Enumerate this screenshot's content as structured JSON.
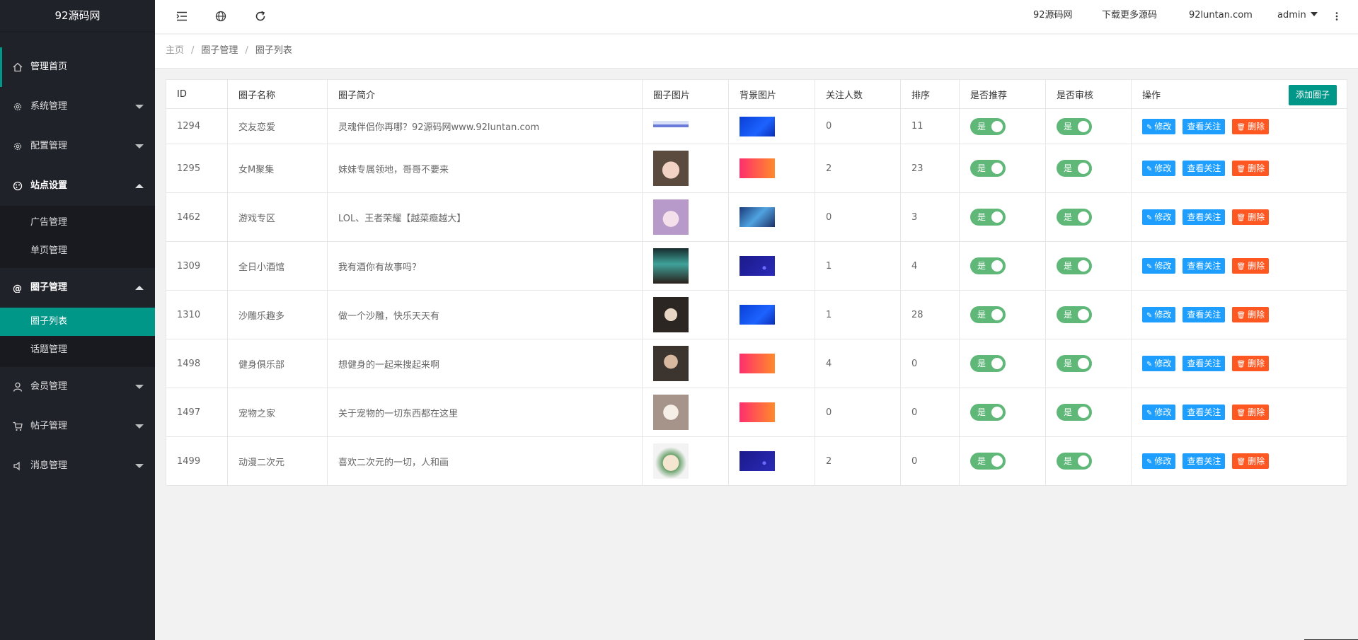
{
  "app": {
    "title": "92源码网"
  },
  "sidebar": {
    "items": [
      {
        "label": "管理首页",
        "icon": "home-icon"
      },
      {
        "label": "系统管理",
        "icon": "gear-icon"
      },
      {
        "label": "配置管理",
        "icon": "gear-icon"
      },
      {
        "label": "站点设置",
        "icon": "palette-icon",
        "sub": [
          "广告管理",
          "单页管理"
        ]
      },
      {
        "label": "圈子管理",
        "icon": "at-icon",
        "sub": [
          "圈子列表",
          "话题管理"
        ]
      },
      {
        "label": "会员管理",
        "icon": "user-icon"
      },
      {
        "label": "帖子管理",
        "icon": "cart-icon"
      },
      {
        "label": "消息管理",
        "icon": "speaker-icon"
      }
    ]
  },
  "header": {
    "links": [
      "92源码网",
      "下载更多源码",
      "92luntan.com"
    ],
    "user": "admin",
    "icons": [
      "menu-fold-icon",
      "globe-icon",
      "refresh-icon",
      "more-vertical-icon"
    ]
  },
  "breadcrumb": [
    "主页",
    "圈子管理",
    "圈子列表"
  ],
  "table": {
    "headers": [
      "ID",
      "圈子名称",
      "圈子简介",
      "圈子图片",
      "背景图片",
      "关注人数",
      "排序",
      "是否推荐",
      "是否审核",
      "操作"
    ],
    "add_button": "添加圈子",
    "switch_label": "是",
    "actions": {
      "edit": "修改",
      "followers": "查看关注",
      "delete": "删除"
    },
    "rows": [
      {
        "id": "1294",
        "name": "交友恋爱",
        "intro": "灵魂伴侣你再哪？92源码网www.92luntan.com",
        "followers": "0",
        "sort": "11",
        "bg": "blue"
      },
      {
        "id": "1295",
        "name": "女M聚集",
        "intro": "妹妹专属领地，哥哥不要来",
        "followers": "2",
        "sort": "23",
        "bg": "orange"
      },
      {
        "id": "1462",
        "name": "游戏专区",
        "intro": "LOL、王者荣耀【越菜瘾越大】",
        "followers": "0",
        "sort": "3",
        "bg": "game"
      },
      {
        "id": "1309",
        "name": "全日小酒馆",
        "intro": "我有酒你有故事吗？",
        "followers": "1",
        "sort": "4",
        "bg": "navy"
      },
      {
        "id": "1310",
        "name": "沙雕乐趣多",
        "intro": "做一个沙雕，快乐天天有",
        "followers": "1",
        "sort": "28",
        "bg": "blue"
      },
      {
        "id": "1498",
        "name": "健身俱乐部",
        "intro": "想健身的一起来搜起来啊",
        "followers": "4",
        "sort": "0",
        "bg": "orange"
      },
      {
        "id": "1497",
        "name": "宠物之家",
        "intro": "关于宠物的一切东西都在这里",
        "followers": "0",
        "sort": "0",
        "bg": "orange"
      },
      {
        "id": "1499",
        "name": "动漫二次元",
        "intro": "喜欢二次元的一切，人和画",
        "followers": "2",
        "sort": "0",
        "bg": "navy"
      }
    ]
  },
  "colors": {
    "accent": "#009688",
    "sidebar": "#20222a",
    "switch": "#5fb878",
    "blue": "#1e9fff",
    "red": "#ff5722"
  }
}
